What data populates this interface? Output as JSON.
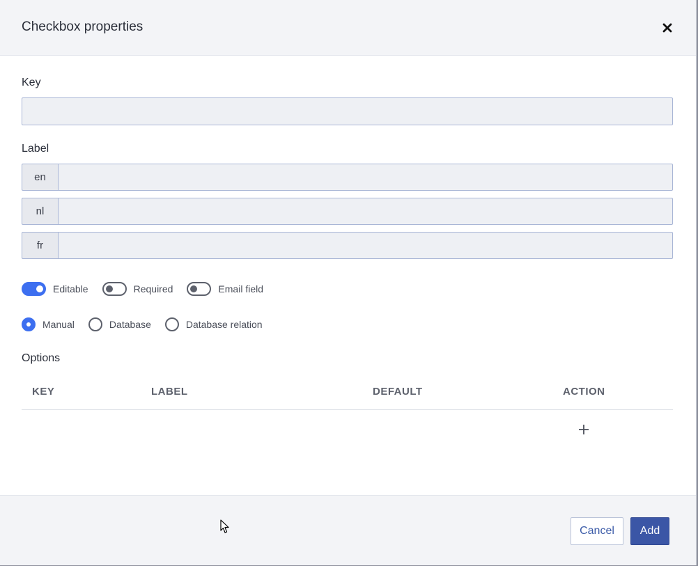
{
  "dialog": {
    "title": "Checkbox properties"
  },
  "key_field": {
    "label": "Key",
    "value": "",
    "placeholder": ""
  },
  "label_field": {
    "label": "Label",
    "languages": [
      {
        "code": "en",
        "value": ""
      },
      {
        "code": "nl",
        "value": ""
      },
      {
        "code": "fr",
        "value": ""
      }
    ]
  },
  "toggles": [
    {
      "label": "Editable",
      "on": true
    },
    {
      "label": "Required",
      "on": false
    },
    {
      "label": "Email field",
      "on": false
    }
  ],
  "source_options": [
    {
      "label": "Manual",
      "checked": true
    },
    {
      "label": "Database",
      "checked": false
    },
    {
      "label": "Database relation",
      "checked": false
    }
  ],
  "options_section": {
    "title": "Options",
    "columns": [
      "KEY",
      "LABEL",
      "DEFAULT",
      "ACTION"
    ],
    "add_icon": "plus-icon"
  },
  "footer": {
    "cancel_label": "Cancel",
    "add_label": "Add"
  },
  "colors": {
    "accent": "#3d6ff0",
    "primary_button": "#3b56a6",
    "input_bg": "#eef0f4",
    "input_border": "#a9b6d6"
  }
}
